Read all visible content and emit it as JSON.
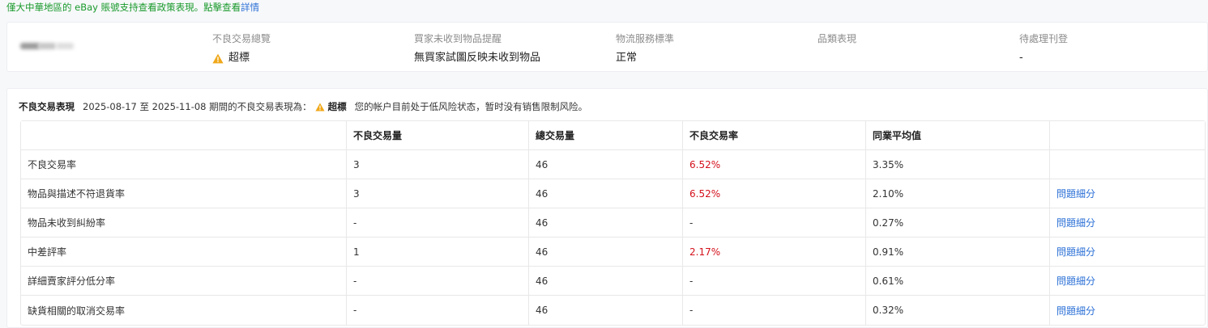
{
  "notice": {
    "text": "僅大中華地區的 eBay 賬號支持查看政策表現。點擊查看",
    "link": "詳情",
    "color": "#1a9a2c",
    "link_color": "#2a6fd6"
  },
  "summary": {
    "columns": [
      {
        "label": "不良交易總覽",
        "value": "超標",
        "icon": "warning-icon"
      },
      {
        "label": "買家未收到物品提醒",
        "value": "無買家試圖反映未收到物品"
      },
      {
        "label": "物流服務標準",
        "value": "正常"
      },
      {
        "label": "品類表現",
        "value": ""
      },
      {
        "label": "待處理刊登",
        "value": "-"
      }
    ]
  },
  "performance": {
    "title": "不良交易表現",
    "period_text": "2025-08-17 至 2025-11-08 期間的不良交易表現為：",
    "status": "超標",
    "status_note": "您的帐户目前处于低风险状态，暂时没有销售限制风险。",
    "headers": [
      "",
      "不良交易量",
      "總交易量",
      "不良交易率",
      "同業平均值",
      ""
    ],
    "rows": [
      {
        "name": "不良交易率",
        "defects": "3",
        "total": "46",
        "rate": "6.52%",
        "rate_bad": true,
        "avg": "3.35%",
        "link": ""
      },
      {
        "name": "物品與描述不符退貨率",
        "defects": "3",
        "total": "46",
        "rate": "6.52%",
        "rate_bad": true,
        "avg": "2.10%",
        "link": "問題細分"
      },
      {
        "name": "物品未收到糾紛率",
        "defects": "-",
        "total": "46",
        "rate": "-",
        "rate_bad": false,
        "avg": "0.27%",
        "link": "問題細分"
      },
      {
        "name": "中差評率",
        "defects": "1",
        "total": "46",
        "rate": "2.17%",
        "rate_bad": true,
        "avg": "0.91%",
        "link": "問題細分"
      },
      {
        "name": "詳細賣家評分低分率",
        "defects": "-",
        "total": "46",
        "rate": "-",
        "rate_bad": false,
        "avg": "0.61%",
        "link": "問題細分"
      },
      {
        "name": "缺貨相關的取消交易率",
        "defects": "-",
        "total": "46",
        "rate": "-",
        "rate_bad": false,
        "avg": "0.32%",
        "link": "問題細分"
      }
    ],
    "bad_color": "#d4111c",
    "warning_color": "#f0a81a"
  }
}
